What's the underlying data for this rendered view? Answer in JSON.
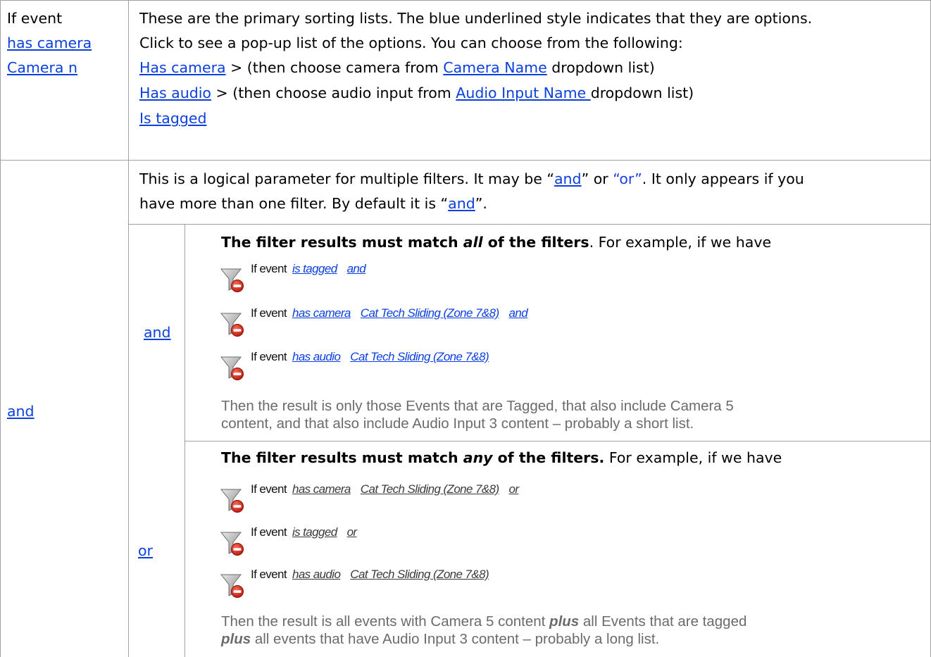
{
  "row1": {
    "left": {
      "label": "If event",
      "link1": "has camera",
      "link2": "Camera n"
    },
    "right": {
      "line1": "These are the primary sorting lists. The blue underlined style indicates that they are options.",
      "line2": "Click to see a pop-up list of the options. You can choose from the following:",
      "opt1_link": "Has camera",
      "opt1_text1": " > (then choose camera from ",
      "opt1_link2": "Camera Name",
      "opt1_text2": " dropdown list)",
      "opt2_link": "Has audio",
      "opt2_text1": " > (then choose audio input from ",
      "opt2_link2": "Audio Input Name ",
      "opt2_text2": "dropdown list)",
      "opt3_link": "Is tagged"
    }
  },
  "row2": {
    "left_link": "and",
    "intro": {
      "p1": "This is a logical parameter for multiple filters. It may be “",
      "and_link": "and",
      "p2": "” or ",
      "or_text": "“or”",
      "p3": ". It only appears if you",
      "p4": "have more than one filter. By default it is “",
      "and_link2": "and",
      "p5": "”."
    },
    "and_block": {
      "left_link": "and",
      "heading_bold1": "The filter results must match ",
      "heading_bolditalic": "all",
      "heading_bold2": " of the filters",
      "heading_rest": ". For example, if we have",
      "filters": [
        {
          "event": "If event",
          "a": "is tagged",
          "b": "and"
        },
        {
          "event": "If event",
          "a": "has camera",
          "b": "Cat Tech Sliding (Zone 7&8)",
          "c": "and"
        },
        {
          "event": "If event",
          "a": "has audio",
          "b": "Cat Tech Sliding (Zone 7&8)"
        }
      ],
      "result_line1": "Then the result is only those Events that are Tagged, that also include Camera 5",
      "result_line2": "content, and that also include Audio Input 3 content – probably a short list."
    },
    "or_block": {
      "left_link": "or",
      "heading_bold1": "The filter results must match ",
      "heading_bolditalic": "any",
      "heading_bold2": " of the filters.",
      "heading_rest": " For example, if we have",
      "filters": [
        {
          "event": "If event",
          "a": "has camera",
          "b": "Cat Tech Sliding (Zone 7&8)",
          "c": "or"
        },
        {
          "event": "If event",
          "a": "is tagged",
          "b": "or"
        },
        {
          "event": "If event",
          "a": "has audio",
          "b": "Cat Tech Sliding (Zone 7&8)"
        }
      ],
      "result_l1_a": "Then the result is all events with Camera 5 content ",
      "result_l1_plus": "plus",
      "result_l1_b": " all Events that are tagged",
      "result_l2_plus": "plus",
      "result_l2_b": " all events that have Audio Input 3 content – probably a long list."
    }
  },
  "icons": {
    "filter": "filter-remove-icon"
  },
  "colors": {
    "link": "#0b3fe0",
    "grid": "#a0a0a0",
    "muted_text": "#6b6b6b"
  }
}
